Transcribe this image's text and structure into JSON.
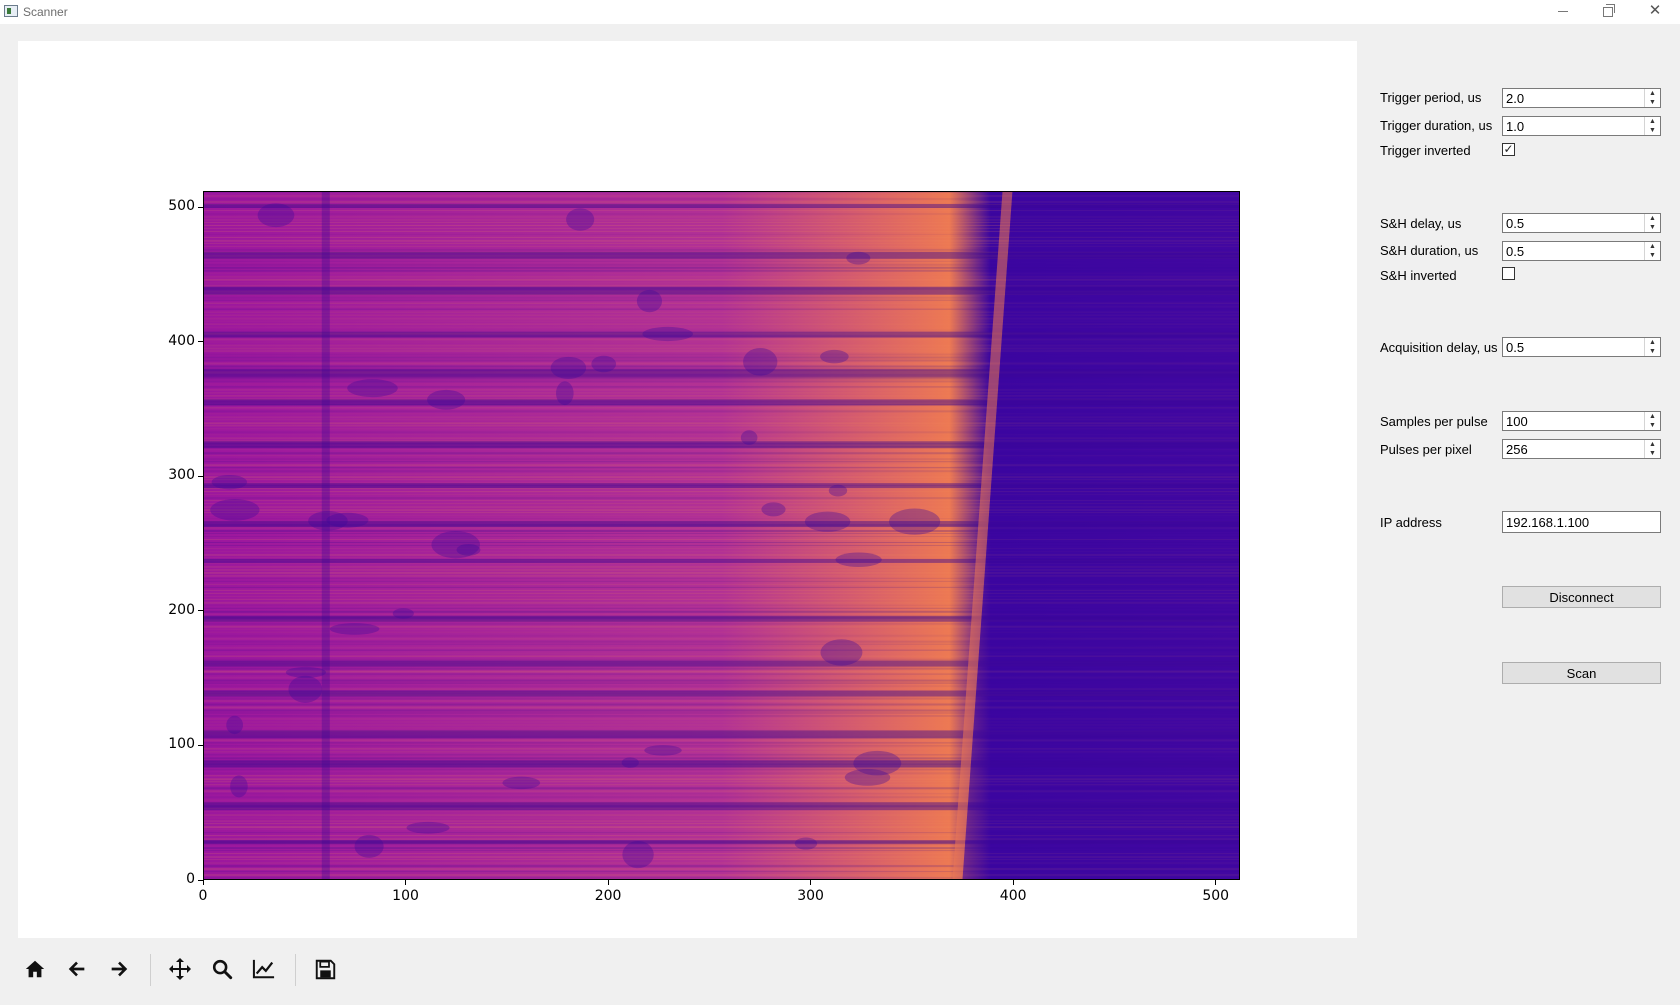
{
  "window": {
    "title": "Scanner",
    "controls": {
      "minimize": "minimize",
      "maximize": "maximize",
      "close": "✕"
    }
  },
  "chart_data": {
    "type": "heatmap",
    "title": "",
    "xlabel": "",
    "ylabel": "",
    "xlim": [
      0,
      512
    ],
    "ylim": [
      0,
      512
    ],
    "x_ticks": [
      "0",
      "100",
      "200",
      "300",
      "400",
      "500"
    ],
    "y_ticks": [
      "0",
      "100",
      "200",
      "300",
      "400",
      "500"
    ],
    "colormap": "plasma",
    "grid": false,
    "legend": "none"
  },
  "toolbar": {
    "items": [
      {
        "name": "home",
        "icon": "home-icon"
      },
      {
        "name": "back",
        "icon": "arrow-left-icon"
      },
      {
        "name": "forward",
        "icon": "arrow-right-icon"
      },
      {
        "name": "pan",
        "icon": "move-icon"
      },
      {
        "name": "zoom",
        "icon": "magnifier-icon"
      },
      {
        "name": "subplots",
        "icon": "chart-line-icon"
      },
      {
        "name": "save",
        "icon": "floppy-disk-icon"
      }
    ]
  },
  "panel": {
    "trigger_period": {
      "label": "Trigger period, us",
      "value": "2.0"
    },
    "trigger_duration": {
      "label": "Trigger duration, us",
      "value": "1.0"
    },
    "trigger_inverted": {
      "label": "Trigger inverted",
      "checked": true,
      "mark": "✓"
    },
    "sh_delay": {
      "label": "S&H delay, us",
      "value": "0.5"
    },
    "sh_duration": {
      "label": "S&H duration, us",
      "value": "0.5"
    },
    "sh_inverted": {
      "label": "S&H inverted",
      "checked": false,
      "mark": ""
    },
    "acquisition_delay": {
      "label": "Acquisition delay, us",
      "value": "0.5"
    },
    "samples_per_pulse": {
      "label": "Samples per pulse",
      "value": "100"
    },
    "pulses_per_pixel": {
      "label": "Pulses per pixel",
      "value": "256"
    },
    "ip_address": {
      "label": "IP address",
      "value": "192.168.1.100"
    },
    "disconnect_label": "Disconnect",
    "scan_label": "Scan"
  },
  "colors": {
    "accent": "#0d0887",
    "heat_low": "#3c06a0",
    "heat_mid": "#9c179e",
    "heat_high": "#ed7953"
  }
}
